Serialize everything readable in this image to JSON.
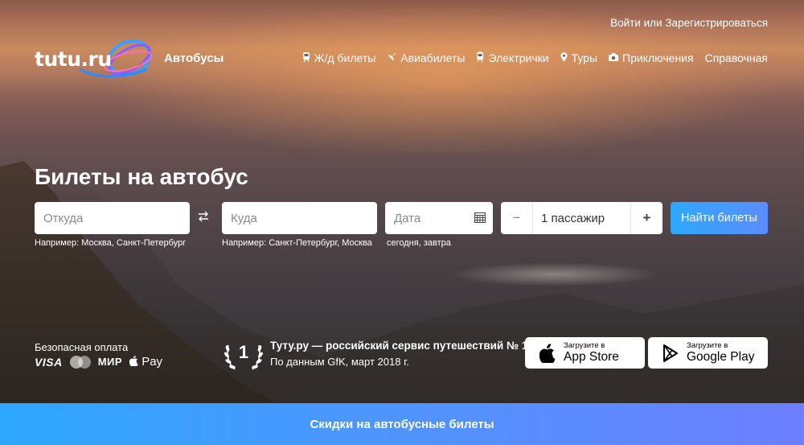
{
  "header": {
    "login_link": "Войти или Зарегистрироваться",
    "logo_text": "tutu.ru",
    "section": "Автобусы",
    "nav": [
      {
        "label": "Ж/д билеты",
        "icon": "train-icon"
      },
      {
        "label": "Авиабилеты",
        "icon": "plane-icon"
      },
      {
        "label": "Электрички",
        "icon": "suburban-train-icon"
      },
      {
        "label": "Туры",
        "icon": "location-pin-icon"
      },
      {
        "label": "Приключения",
        "icon": "camera-icon"
      },
      {
        "label": "Справочная",
        "icon": ""
      }
    ]
  },
  "search": {
    "title": "Билеты на автобус",
    "from": {
      "placeholder": "Откуда",
      "value": "",
      "hint": "Например: Москва, Санкт-Петербург"
    },
    "to": {
      "placeholder": "Куда",
      "value": "",
      "hint": "Например: Санкт-Петербург, Москва"
    },
    "date": {
      "placeholder": "Дата",
      "value": "",
      "hint": "сегодня, завтра"
    },
    "passengers": {
      "minus": "−",
      "value": "1 пассажир",
      "plus": "+"
    },
    "submit_label": "Найти билеты"
  },
  "footer": {
    "payment": {
      "title": "Безопасная оплата",
      "visa": "VISA",
      "mir": "МИР",
      "apple_pay": "Pay"
    },
    "award": {
      "number": "1",
      "title": "Туту.ру — российский сервис путешествий № 1",
      "subtitle": "По данным GfK, март 2018 г."
    },
    "app_store": {
      "small": "Загрузите в",
      "big": "App Store"
    },
    "google_play": {
      "small": "Загрузите в",
      "big": "Google Play"
    }
  },
  "promo_banner": "Скидки на автобусные билеты",
  "colors": {
    "accent_start": "#2ea8ff",
    "accent_end": "#6d7fff"
  }
}
